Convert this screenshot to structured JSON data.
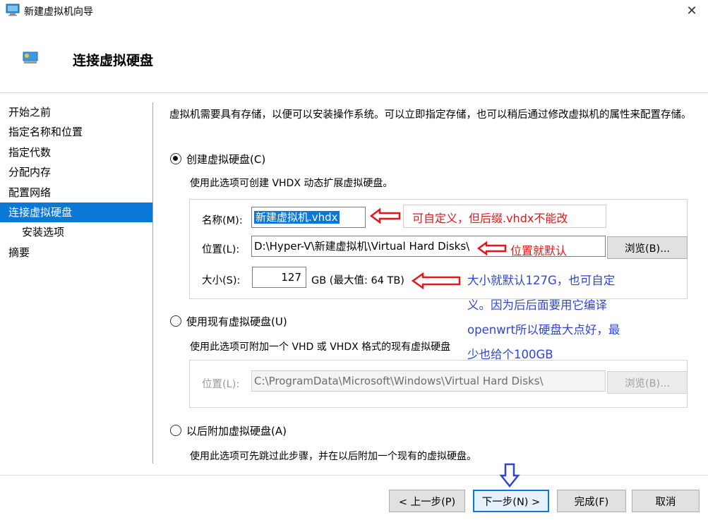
{
  "window": {
    "title": "新建虚拟机向导",
    "close_symbol": "✕"
  },
  "header": {
    "title": "连接虚拟硬盘"
  },
  "nav": {
    "items": [
      {
        "label": "开始之前"
      },
      {
        "label": "指定名称和位置"
      },
      {
        "label": "指定代数"
      },
      {
        "label": "分配内存"
      },
      {
        "label": "配置网络"
      },
      {
        "label": "连接虚拟硬盘"
      },
      {
        "label": "安装选项"
      },
      {
        "label": "摘要"
      }
    ],
    "active_index": 5
  },
  "main": {
    "description": "虚拟机需要具有存储，以便可以安装操作系统。可以立即指定存储，也可以稍后通过修改虚拟机的属性来配置存储。",
    "create_option": {
      "label": "创建虚拟硬盘(C)",
      "selected": true,
      "description": "使用此选项可创建 VHDX 动态扩展虚拟硬盘。",
      "name_label": "名称(M):",
      "name_value": "新建虚拟机.vhdx",
      "location_label": "位置(L):",
      "location_value": "D:\\Hyper-V\\新建虚拟机\\Virtual Hard Disks\\",
      "browse_label": "浏览(B)...",
      "size_label": "大小(S):",
      "size_value": "127",
      "size_unit": "GB (最大值: 64 TB)"
    },
    "existing_option": {
      "label": "使用现有虚拟硬盘(U)",
      "selected": false,
      "description": "使用此选项可附加一个 VHD 或 VHDX 格式的现有虚拟硬盘",
      "location_label": "位置(L):",
      "location_value": "C:\\ProgramData\\Microsoft\\Windows\\Virtual Hard Disks\\",
      "browse_label": "浏览(B)..."
    },
    "later_option": {
      "label": "以后附加虚拟硬盘(A)",
      "selected": false,
      "description": "使用此选项可先跳过此步骤，并在以后附加一个现有的虚拟硬盘。"
    }
  },
  "footer": {
    "prev_label": "< 上一步(P)",
    "next_label": "下一步(N) >",
    "finish_label": "完成(F)",
    "cancel_label": "取消"
  },
  "annotations": {
    "name_note": "可自定义，但后缀.vhdx不能改",
    "location_note": "位置就默认",
    "size_note": "大小就默认127G，也可自定义。因为后后面要用它编译openwrt所以硬盘大点好，最少也给个100GB"
  },
  "colors": {
    "accent": "#0a78d7",
    "annotation_red": "#e3161b",
    "annotation_blue": "#2f45d6"
  }
}
